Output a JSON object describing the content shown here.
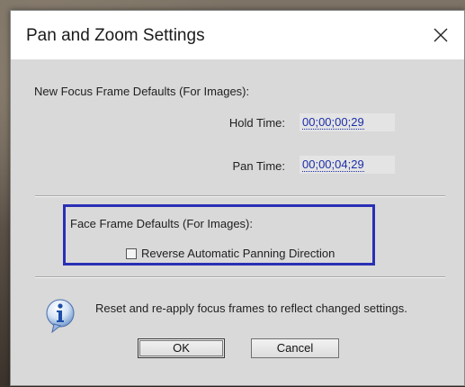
{
  "dialog": {
    "title": "Pan and Zoom Settings"
  },
  "focus_frame": {
    "heading": "New Focus Frame Defaults (For Images):",
    "hold_time_label": "Hold Time:",
    "hold_time_value": "00;00;00;29",
    "pan_time_label": "Pan Time:",
    "pan_time_value": "00;00;04;29"
  },
  "face_frame": {
    "heading": "Face Frame Defaults (For Images):",
    "reverse_panning_label": "Reverse Automatic Panning Direction",
    "reverse_panning_checked": false
  },
  "info": {
    "message": "Reset and re-apply focus frames to reflect changed settings."
  },
  "buttons": {
    "ok_label": "OK",
    "cancel_label": "Cancel"
  },
  "colors": {
    "highlight_border": "#2a2fb5",
    "timecode_text": "#1d2ea8",
    "dialog_body": "#d9d9d9"
  }
}
